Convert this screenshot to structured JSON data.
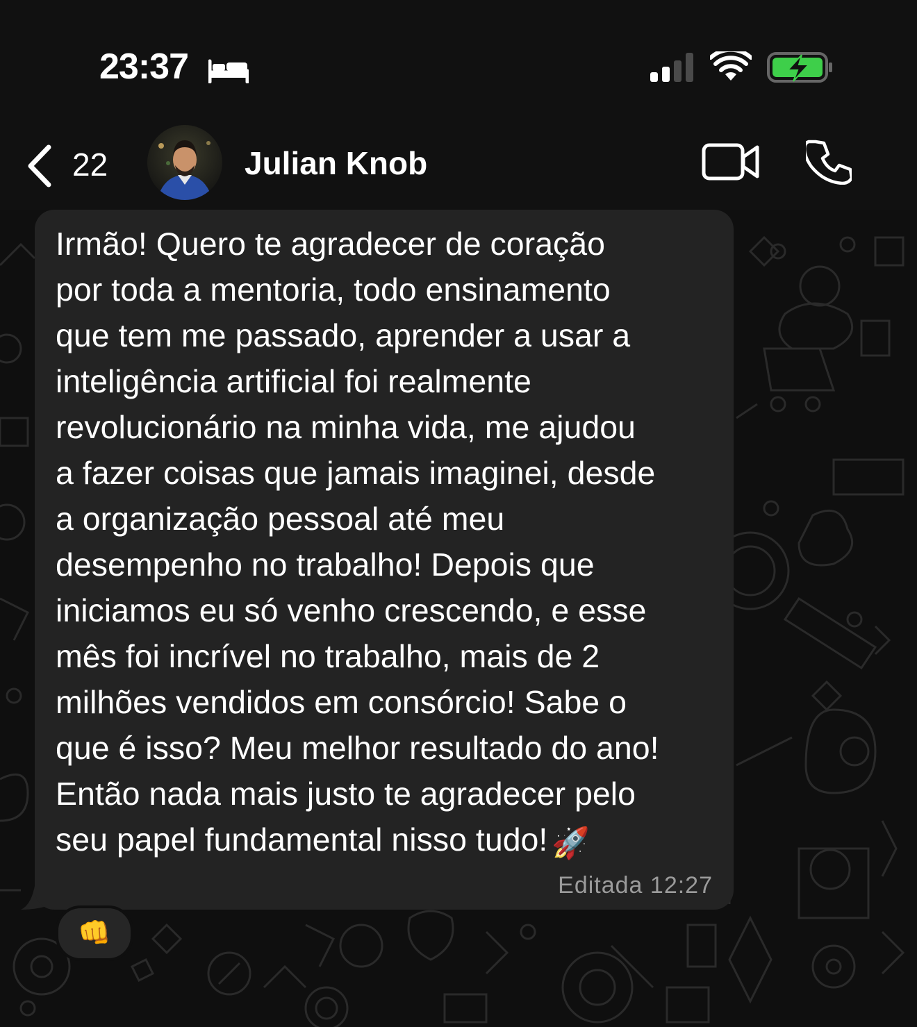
{
  "status_bar": {
    "time": "23:37",
    "focus_icon": "bed-icon",
    "signal_icon": "cellular-signal-icon",
    "wifi_icon": "wifi-icon",
    "battery_icon": "battery-charging-icon",
    "battery_color": "#3ecf4a"
  },
  "header": {
    "back_count": "22",
    "contact_name": "Julian Knob",
    "video_icon": "video-camera-icon",
    "call_icon": "phone-icon"
  },
  "message": {
    "text": "Irmão! Quero te agradecer de coração\npor toda a mentoria, todo ensinamento\nque tem me passado, aprender a usar a\ninteligência artificial foi realmente\nrevolucionário na minha vida, me ajudou\na fazer coisas que jamais imaginei, desde\na organização pessoal até meu\ndesempenho no trabalho! Depois que\niniciamos eu só venho crescendo, e esse\nmês foi incrível no trabalho, mais de 2\nmilhões vendidos em consórcio! Sabe o\nque é isso? Meu melhor resultado do ano!\nEntão nada mais justo te agradecer pelo\nseu papel fundamental nisso tudo!",
    "emoji": "🚀",
    "meta": "Editada 12:27",
    "reaction": "👊"
  },
  "colors": {
    "background": "#0f0f0f",
    "bubble": "#232323",
    "meta_text": "#9b9b9b"
  }
}
